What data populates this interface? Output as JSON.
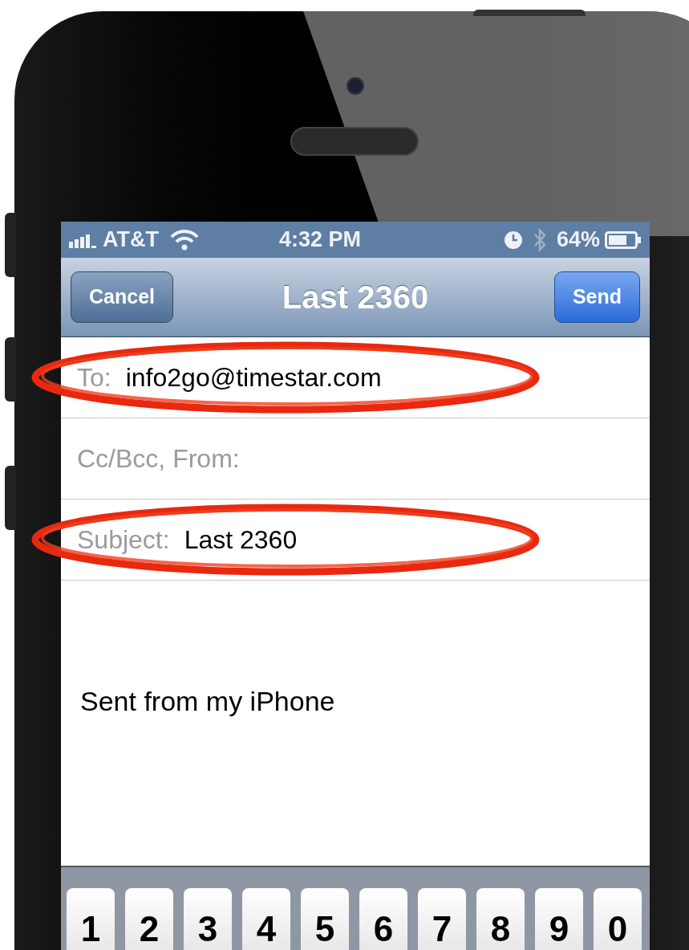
{
  "status_bar": {
    "carrier": "AT&T",
    "time": "4:32 PM",
    "battery": "64%"
  },
  "nav_bar": {
    "title": "Last 2360",
    "buttons": [
      {
        "label": "Cancel",
        "kind": "cancel"
      },
      {
        "label": "Send",
        "kind": "send"
      }
    ]
  },
  "fields": [
    {
      "label": "To:",
      "value": "info2go@timestar.com",
      "circled": true
    },
    {
      "label": "Cc/Bcc, From:",
      "circled": false
    },
    {
      "label": "Subject:",
      "value": "Last 2360",
      "circled": true
    }
  ],
  "body": "Sent from my iPhone",
  "keyboard": {
    "keys": [
      "1",
      "2",
      "3",
      "4",
      "5",
      "6",
      "7",
      "8",
      "9",
      "0"
    ]
  }
}
